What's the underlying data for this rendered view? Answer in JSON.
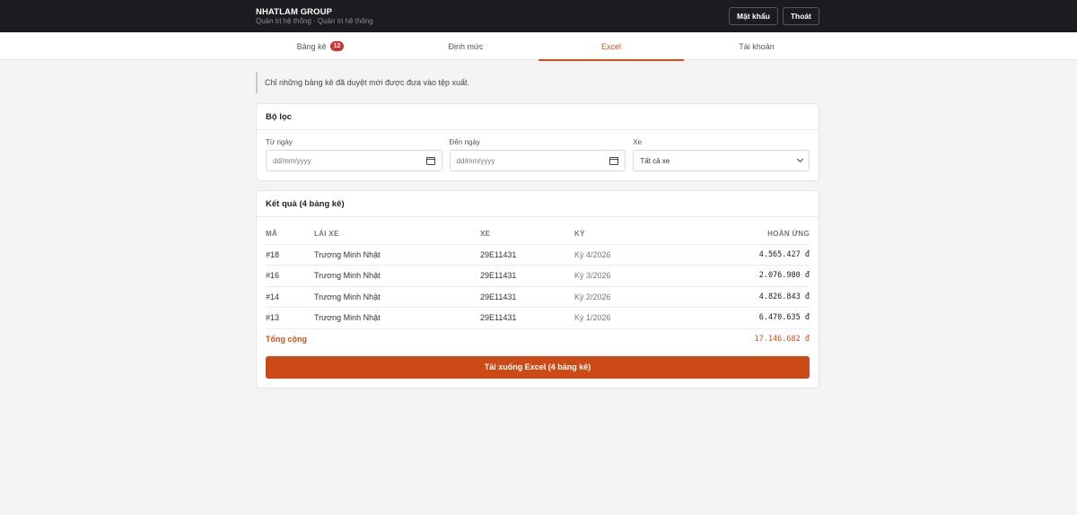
{
  "header": {
    "brand": "NHATLAM GROUP",
    "subtitle": "Quản trị hệ thống · Quản trị hệ thống",
    "password_label": "Mật khẩu",
    "logout_label": "Thoát"
  },
  "tabs": [
    {
      "label": "Bảng kê",
      "badge": "12"
    },
    {
      "label": "Định mức"
    },
    {
      "label": "Excel"
    },
    {
      "label": "Tài khoản"
    }
  ],
  "notice": "Chỉ những bảng kê đã duyệt mới được đưa vào tệp xuất.",
  "filter": {
    "title": "Bộ lọc",
    "from_label": "Từ ngày",
    "from_placeholder": "dd/mm/yyyy",
    "to_label": "Đến ngày",
    "to_placeholder": "dd/mm/yyyy",
    "vehicle_label": "Xe",
    "vehicle_value": "Tất cả xe"
  },
  "results": {
    "title": "Kết quả (4 bảng kê)",
    "columns": [
      "MÃ",
      "LÁI XE",
      "XE",
      "KỲ",
      "HOÀN ỨNG"
    ],
    "rows": [
      {
        "id": "#18",
        "driver": "Trương Minh Nhật",
        "vehicle": "29E11431",
        "period": "Kỳ 4/2026",
        "amount": "4.565.427 đ"
      },
      {
        "id": "#16",
        "driver": "Trương Minh Nhật",
        "vehicle": "29E11431",
        "period": "Kỳ 3/2026",
        "amount": "2.076.980 đ"
      },
      {
        "id": "#14",
        "driver": "Trương Minh Nhật",
        "vehicle": "29E11431",
        "period": "Kỳ 2/2026",
        "amount": "4.826.843 đ"
      },
      {
        "id": "#13",
        "driver": "Trương Minh Nhật",
        "vehicle": "29E11431",
        "period": "Kỳ 1/2026",
        "amount": "6.470.635 đ"
      }
    ],
    "total_label": "Tổng cộng",
    "total_value": "17.146.682 đ",
    "download_label": "Tải xuống Excel (4 bảng kê)"
  },
  "colors": {
    "accent": "#d4501c",
    "button": "#cc4a16",
    "topbar": "#1b1c20",
    "badge": "#d4312a"
  }
}
